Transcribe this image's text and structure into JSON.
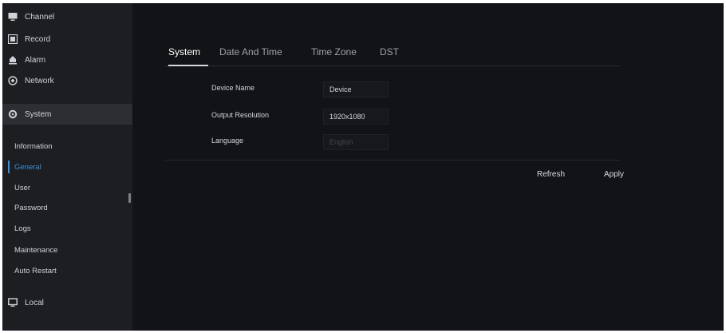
{
  "sidebar": {
    "items": [
      {
        "label": "Channel",
        "icon": "monitor-icon"
      },
      {
        "label": "Record",
        "icon": "record-icon"
      },
      {
        "label": "Alarm",
        "icon": "alarm-icon"
      },
      {
        "label": "Network",
        "icon": "network-icon"
      },
      {
        "label": "System",
        "icon": "gear-icon"
      },
      {
        "label": "Local",
        "icon": "local-icon"
      }
    ],
    "subitems": [
      {
        "label": "Information"
      },
      {
        "label": "General"
      },
      {
        "label": "User"
      },
      {
        "label": "Password"
      },
      {
        "label": "Logs"
      },
      {
        "label": "Maintenance"
      },
      {
        "label": "Auto Restart"
      }
    ]
  },
  "tabs": [
    "System",
    "Date And Time",
    "Time Zone",
    "DST"
  ],
  "form": {
    "device_name_label": "Device Name",
    "device_name_value": "Device",
    "output_resolution_label": "Output Resolution",
    "output_resolution_value": "1920x1080",
    "language_label": "Language",
    "language_value": "English"
  },
  "buttons": {
    "refresh": "Refresh",
    "apply": "Apply"
  },
  "colors": {
    "accent": "#3a8fd6",
    "warning": "#9b1414",
    "background": "#121316",
    "sidebar": "#1d1e22"
  }
}
